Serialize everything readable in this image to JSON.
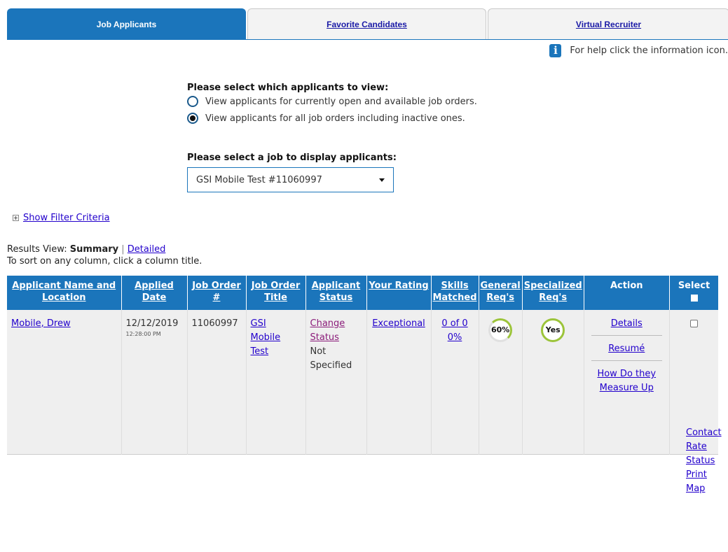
{
  "tabs": [
    {
      "label": "Job Applicants"
    },
    {
      "label": "Favorite Candidates"
    },
    {
      "label": "Virtual Recruiter"
    }
  ],
  "help_text": "For help click the information icon.",
  "view_section": {
    "title": "Please select which applicants to view:",
    "options": [
      {
        "label": "View applicants for currently open and available job orders.",
        "selected": false
      },
      {
        "label": "View applicants for all job orders including inactive ones.",
        "selected": true
      }
    ]
  },
  "job_section": {
    "title": "Please select a job to display applicants:",
    "selected": "GSI Mobile Test #11060997"
  },
  "filter_link": "Show Filter Criteria",
  "results": {
    "label": "Results View:",
    "summary": "Summary",
    "separator": "|",
    "detailed": "Detailed",
    "sort_hint": "To sort on any column, click a column title."
  },
  "table": {
    "headers": {
      "name_line1": "Applicant Name and",
      "name_line2": "Location",
      "applied_line1": "Applied",
      "applied_line2": "Date",
      "job_order_line1": "Job Order",
      "job_order_line2": "#",
      "title_line1": "Job Order",
      "title_line2": "Title",
      "status_line1": "Applicant",
      "status_line2": "Status",
      "rating": "Your Rating",
      "skills_line1": "Skills",
      "skills_line2": "Matched",
      "general_line1": "General",
      "general_line2": "Req's",
      "special_line1": "Specialized",
      "special_line2": "Req's",
      "action": "Action",
      "select": "Select"
    },
    "row": {
      "name": "Mobile, Drew",
      "applied_date": "12/12/2019",
      "applied_time": "12:28:00 PM",
      "job_order": "11060997",
      "title_line1": "GSI",
      "title_line2": "Mobile",
      "title_line3": "Test",
      "change_line1": "Change",
      "change_line2": "Status",
      "status_line1": "Not",
      "status_line2": "Specified",
      "rating": "Exceptional",
      "skills_line1": "0 of 0",
      "skills_line2": "0%",
      "general": "60%",
      "special": "Yes",
      "actions": {
        "details": "Details",
        "resume": "Resumé",
        "measure_line1": "How Do they",
        "measure_line2": "Measure Up"
      }
    },
    "side_links": [
      "Contact",
      "Rate",
      "Status",
      "Print",
      "Map"
    ]
  },
  "colors": {
    "primary": "#1b75bb",
    "match_green": "#9cc43a",
    "link": "#2200cc",
    "status_purple": "#8b1c7a"
  }
}
